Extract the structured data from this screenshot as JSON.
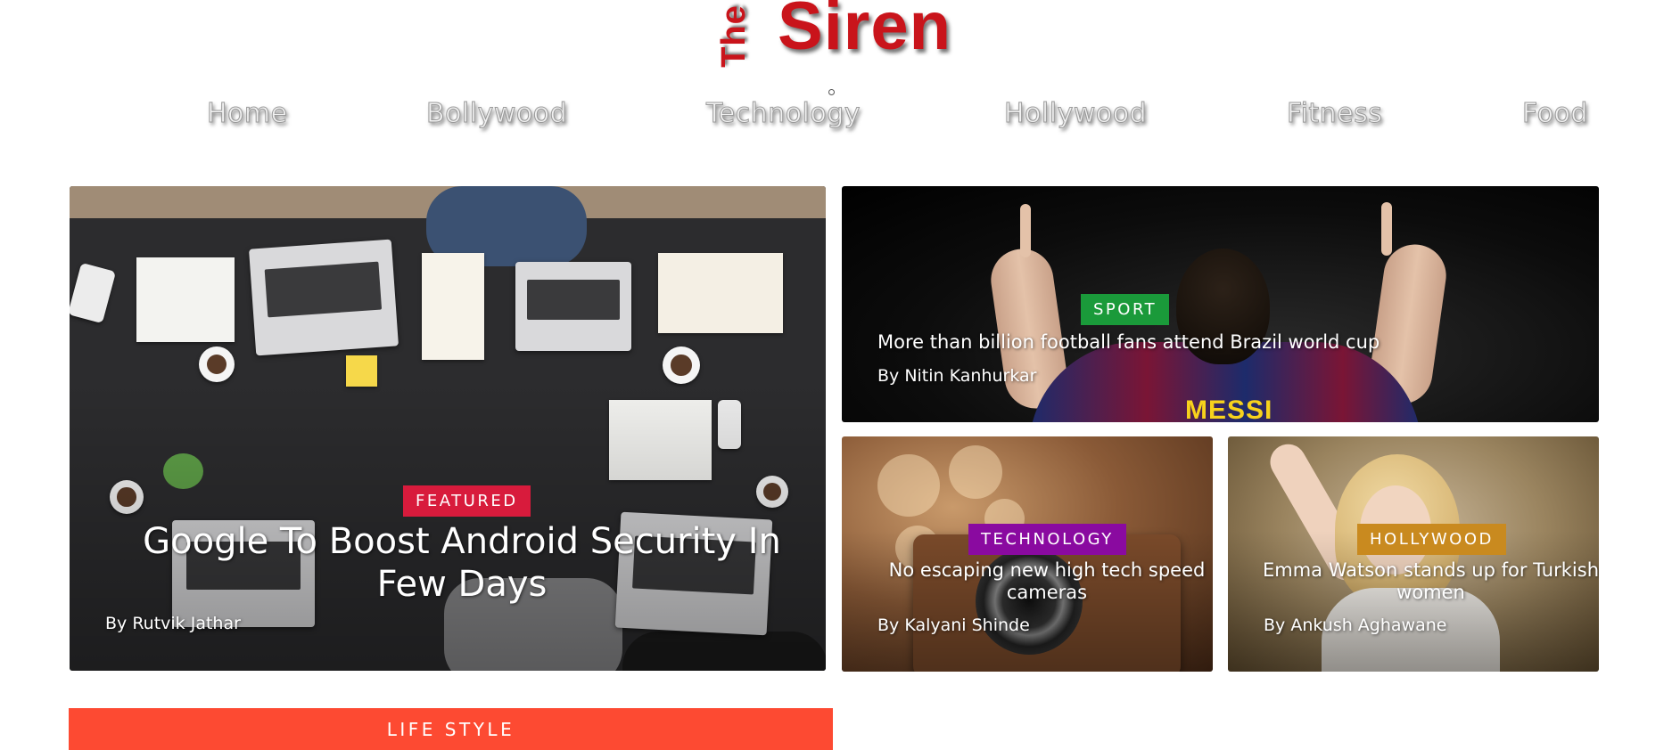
{
  "site": {
    "logo_the": "The",
    "logo_siren": "Siren",
    "brand_color": "#c9141b"
  },
  "nav": {
    "items": [
      {
        "label": "Home"
      },
      {
        "label": "Bollywood"
      },
      {
        "label": "Technology"
      },
      {
        "label": "Hollywood"
      },
      {
        "label": "Fitness"
      },
      {
        "label": "Food"
      }
    ]
  },
  "articles": {
    "featured": {
      "category": "FEATURED",
      "category_color": "#d81b3c",
      "title": "Google To Boost Android Security In Few Days",
      "author": "By Rutvik Jathar"
    },
    "sport": {
      "category": "SPORT",
      "category_color": "#1a9a3a",
      "title": "More than billion football fans attend Brazil world cup",
      "author": "By Nitin Kanhurkar",
      "jersey_text": "MESSI"
    },
    "technology": {
      "category": "TECHNOLOGY",
      "category_color": "#8a0aa0",
      "title": "No escaping new high tech speed cameras",
      "author": "By Kalyani Shinde"
    },
    "hollywood": {
      "category": "HOLLYWOOD",
      "category_color": "#c98a1f",
      "title": "Emma Watson stands up for Turkish women",
      "author": "By Ankush Aghawane"
    }
  },
  "sections": {
    "lifestyle": "LIFE STYLE",
    "lifestyle_color": "#fd4a32"
  }
}
